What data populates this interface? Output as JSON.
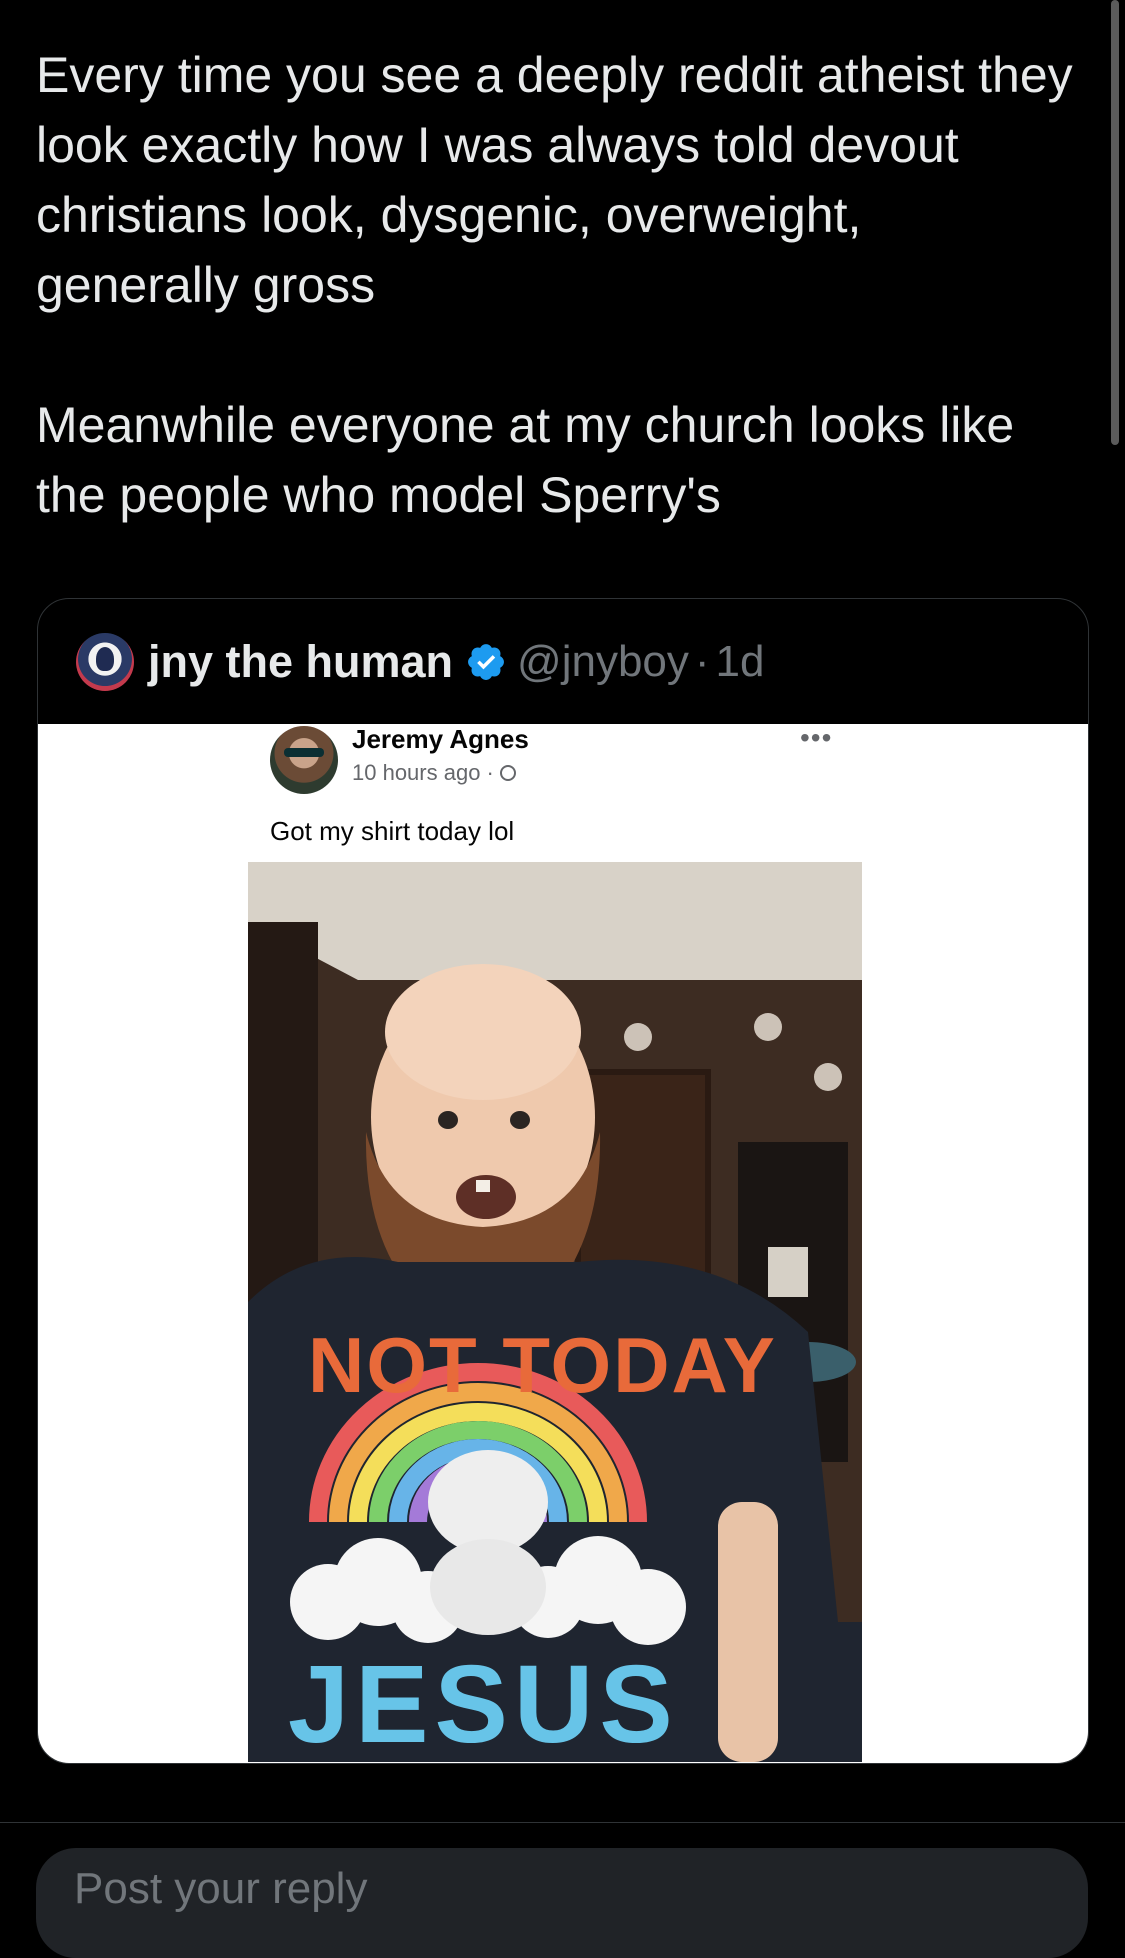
{
  "tweet": {
    "text": "Every time you see a deeply reddit atheist they look exactly how I was always told devout christians look, dysgenic, overweight, generally gross\n\nMeanwhile everyone at my church looks like the people who model Sperry's"
  },
  "quote": {
    "display_name": "jny the human",
    "handle": "@jnyboy",
    "separator": "·",
    "time": "1d",
    "verified": true,
    "media": {
      "post_author": "Jeremy Agnes",
      "post_time": "10 hours ago ·",
      "post_caption": "Got my shirt today lol",
      "shirt_line_1": "NOT TODAY",
      "shirt_line_2": "JESUS"
    }
  },
  "reply": {
    "placeholder": "Post your reply"
  },
  "colors": {
    "background": "#000000",
    "text": "#e7e9ea",
    "muted": "#71767b",
    "verified": "#1d9bf0",
    "border": "#2f3336"
  }
}
